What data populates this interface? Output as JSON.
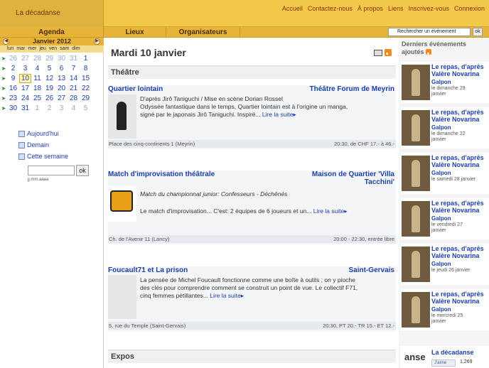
{
  "brand": "La décadanse",
  "topnav": [
    "Accueil",
    "Contactez-nous",
    "À propos",
    "Liens",
    "Inscrivez-vous",
    "Connexion"
  ],
  "navbar": {
    "agenda": "Agenda",
    "lieux": "Lieux",
    "organisateurs": "Organisateurs",
    "search_placeholder": "Rechercher un événement",
    "search_ok": "ok"
  },
  "calendar": {
    "month": "Janvier 2012",
    "days": [
      "lun",
      "mar",
      "mer",
      "jeu",
      "ven",
      "sam",
      "dim"
    ],
    "weeks": [
      [
        "26",
        "27",
        "28",
        "29",
        "30",
        "31",
        "1"
      ],
      [
        "2",
        "3",
        "4",
        "5",
        "6",
        "7",
        "8"
      ],
      [
        "9",
        "10",
        "11",
        "12",
        "13",
        "14",
        "15"
      ],
      [
        "16",
        "17",
        "18",
        "19",
        "20",
        "21",
        "22"
      ],
      [
        "23",
        "24",
        "25",
        "26",
        "27",
        "28",
        "29"
      ],
      [
        "30",
        "31",
        "1",
        "2",
        "3",
        "4",
        "5"
      ]
    ],
    "today": "10"
  },
  "quicklinks": [
    "Aujourd'hui",
    "Demain",
    "Cette semaine"
  ],
  "date_form": {
    "ok": "ok",
    "hint": "jj.mm.aaaa"
  },
  "main": {
    "date_title": "Mardi 10 janvier",
    "section_theatre": "Théâtre",
    "section_expos": "Expos",
    "events": [
      {
        "title": "Quartier lointain",
        "venue": "Théâtre Forum de Meyrin",
        "line1": "D'après Jirô Taniguchi / Mise en scène Dorian Rossel",
        "line2": "Odyssée fantastique dans le temps, Quartier lointain est à l'origine un manga,",
        "line3": "signé par le japonais Jirô Taniguchi. Inspiré... ",
        "more": "Lire la suite",
        "address": "Place des cinq-continents 1 (Meyrin)",
        "info": "20:30, de CHF 17.- à 46.-"
      },
      {
        "title": "Match d'improvisation théâtrale",
        "venue1": "Maison de Quartier 'Villa",
        "venue2": "Tacchini'",
        "line1": "Match du championnat junior: Confesseurs - Déchênés",
        "line2": "Le match d'improvisation... C'est: 2 équipes de 6 joueurs et un... ",
        "more": "Lire la suite",
        "address": "Ch. de l'Avenir 11 (Lancy)",
        "info": "20:00 - 22:30, entrée libre"
      },
      {
        "title": "Foucault71 et La prison",
        "venue": "Saint-Gervais",
        "line1": "La pensée de Michel Foucault fonctionne comme une boîte à outils ; on y pioche",
        "line2": "des clés pour comprendre comment se construit un point de vue. Le collectif F71,",
        "line3": "cinq femmes pétillantes... ",
        "more": "Lire la suite",
        "address": "5, rue du Temple (Saint-Gervais)",
        "info": "20:30, PT 20.- TR 15.- ET 12.-"
      }
    ]
  },
  "sidebar": {
    "heading1": "Derniers événements",
    "heading2": "ajoutés",
    "items": [
      {
        "t1": "Le repas, d'après",
        "t2": "Valère Novarina",
        "place": "Galpon",
        "d1": "le dimanche 29",
        "d2": "janvier"
      },
      {
        "t1": "Le repas, d'après",
        "t2": "Valère Novarina",
        "place": "Galpon",
        "d1": "le dimanche 22",
        "d2": "janvier"
      },
      {
        "t1": "Le repas, d'après",
        "t2": "Valère Novarina",
        "place": "Galpon",
        "d1": "le samedi 28 janvier",
        "d2": ""
      },
      {
        "t1": "Le repas, d'après",
        "t2": "Valère Novarina",
        "place": "Galpon",
        "d1": "le vendredi 27",
        "d2": "janvier"
      },
      {
        "t1": "Le repas, d'après",
        "t2": "Valère Novarina",
        "place": "Galpon",
        "d1": "le jeudi 26 janvier",
        "d2": ""
      },
      {
        "t1": "Le repas, d'après",
        "t2": "Valère Novarina",
        "place": "Galpon",
        "d1": "le mercredi 25",
        "d2": "janvier"
      }
    ],
    "fb_logo": "anse",
    "fb_name": "La décadanse",
    "fb_like": "J'aime",
    "fb_count": "1,269"
  }
}
